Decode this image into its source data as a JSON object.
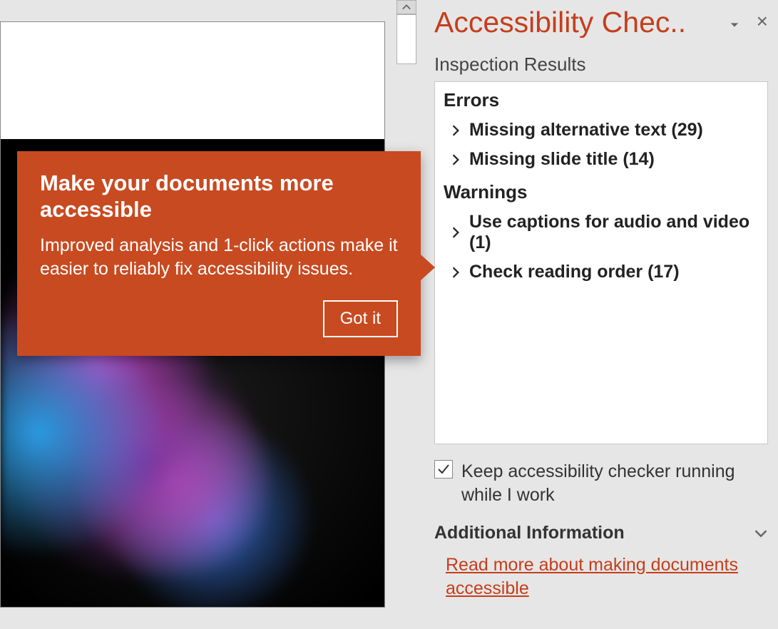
{
  "slide": {
    "alt_placeholder": "Slide preview with colorful ink image"
  },
  "panel": {
    "title": "Accessibility Chec..",
    "section_label": "Inspection Results",
    "groups": [
      {
        "header": "Errors",
        "items": [
          {
            "label": "Missing alternative text (29)"
          },
          {
            "label": "Missing slide title (14)"
          }
        ]
      },
      {
        "header": "Warnings",
        "items": [
          {
            "label": "Use captions for audio and video (1)"
          },
          {
            "label": "Check reading order (17)"
          }
        ]
      }
    ],
    "keep_running_checked": true,
    "keep_running_label": "Keep accessibility checker running while I work",
    "additional_info_header": "Additional Information",
    "additional_info_link": "Read more about making documents accessible"
  },
  "callout": {
    "title": "Make your documents more accessible",
    "body": "Improved analysis and 1-click actions make it easier to reliably fix accessibility issues.",
    "button": "Got it"
  },
  "colors": {
    "accent": "#c43e1c",
    "callout_bg": "#c84a21"
  }
}
